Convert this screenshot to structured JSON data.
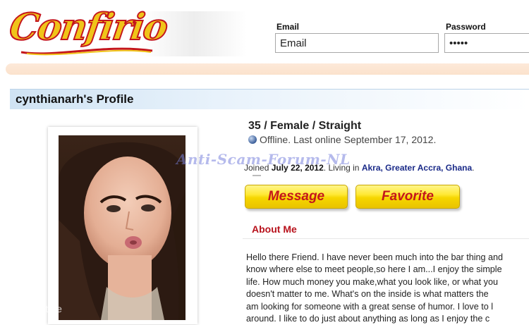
{
  "brand": {
    "logo_text": "Confirio",
    "logo_fill": "#f0c419",
    "logo_stroke": "#c4161c"
  },
  "login": {
    "email_label": "Email",
    "email_value": "Email",
    "password_label": "Password",
    "password_value": "•••••"
  },
  "profile": {
    "title": "cynthianarh's Profile",
    "demographics": "35 / Female / Straight",
    "status_text": "Offline. Last online September 17, 2012.",
    "joined_prefix": "Joined",
    "joined_date": "July 22, 2012",
    "living_prefix": ". Living in",
    "location": "Akra, Greater Accra, Ghana",
    "location_suffix": "."
  },
  "watermark": "Anti-Scam-Forum-NL",
  "actions": {
    "message_label": "Message",
    "favorite_label": "Favorite"
  },
  "about": {
    "heading": "About Me",
    "lines": [
      "Hello there Friend. I have never been much into the bar thing and",
      "know where else to meet people,so here I am...I enjoy the simple",
      "life. How much money you make,what you look like, or what you",
      "doesn't matter to me. What's on the inside is what matters the",
      "am looking for someone with a great sense of humor. I love to l",
      "around. I like to do just about anything as long as I enjoy the c"
    ]
  },
  "footer_mark": "rnist.de",
  "icons": {
    "status": "offline-status-icon"
  }
}
